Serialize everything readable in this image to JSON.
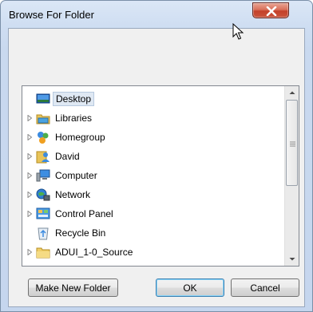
{
  "window": {
    "title": "Browse For Folder"
  },
  "tree": {
    "items": [
      {
        "label": "Desktop",
        "icon": "desktop-icon",
        "selected": true,
        "expandable": false
      },
      {
        "label": "Libraries",
        "icon": "libraries-icon",
        "expandable": true
      },
      {
        "label": "Homegroup",
        "icon": "homegroup-icon",
        "expandable": true
      },
      {
        "label": "David",
        "icon": "user-folder-icon",
        "expandable": true
      },
      {
        "label": "Computer",
        "icon": "computer-icon",
        "expandable": true
      },
      {
        "label": "Network",
        "icon": "network-icon",
        "expandable": true
      },
      {
        "label": "Control Panel",
        "icon": "control-panel-icon",
        "expandable": true
      },
      {
        "label": "Recycle Bin",
        "icon": "recycle-bin-icon",
        "expandable": false
      },
      {
        "label": "ADUI_1-0_Source",
        "icon": "folder-icon",
        "expandable": true
      }
    ]
  },
  "buttons": {
    "make_new_folder": "Make New Folder",
    "ok": "OK",
    "cancel": "Cancel"
  },
  "colors": {
    "frame": "#c9d9ef",
    "close": "#c4412a",
    "selection": "#dfe8f3"
  }
}
